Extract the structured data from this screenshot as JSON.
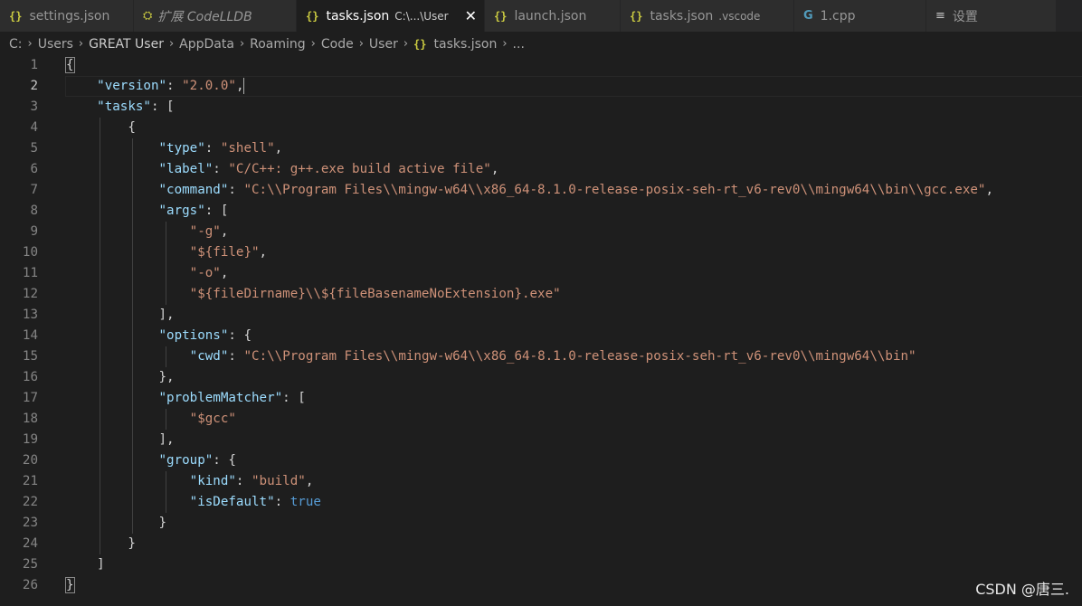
{
  "tabs": [
    {
      "icon": "json-braces-icon",
      "label": "settings.json",
      "desc": "",
      "active": false,
      "italic": false
    },
    {
      "icon": "extension-icon",
      "label": "扩展 CodeLLDB",
      "desc": "",
      "active": false,
      "italic": true
    },
    {
      "icon": "json-braces-icon",
      "label": "tasks.json",
      "desc": "C:\\...\\User",
      "active": true,
      "italic": false
    },
    {
      "icon": "json-braces-icon",
      "label": "launch.json",
      "desc": "",
      "active": false,
      "italic": false
    },
    {
      "icon": "json-braces-icon",
      "label": "tasks.json",
      "desc": ".vscode",
      "active": false,
      "italic": false
    },
    {
      "icon": "cpp-icon",
      "label": "1.cpp",
      "desc": "",
      "active": false,
      "italic": false
    },
    {
      "icon": "menu-icon",
      "label": "设置",
      "desc": "",
      "active": false,
      "italic": false
    }
  ],
  "breadcrumb": [
    "C:",
    "Users",
    "GREAT User",
    "AppData",
    "Roaming",
    "Code",
    "User",
    "tasks.json",
    "..."
  ],
  "editor": {
    "current_line": 2,
    "lines": [
      "{",
      "    \"version\": \"2.0.0\",",
      "    \"tasks\": [",
      "        {",
      "            \"type\": \"shell\",",
      "            \"label\": \"C/C++: g++.exe build active file\",",
      "            \"command\": \"C:\\\\Program Files\\\\mingw-w64\\\\x86_64-8.1.0-release-posix-seh-rt_v6-rev0\\\\mingw64\\\\bin\\\\gcc.exe\",",
      "            \"args\": [",
      "                \"-g\",",
      "                \"${file}\",",
      "                \"-o\",",
      "                \"${fileDirname}\\\\${fileBasenameNoExtension}.exe\"",
      "            ],",
      "            \"options\": {",
      "                \"cwd\": \"C:\\\\Program Files\\\\mingw-w64\\\\x86_64-8.1.0-release-posix-seh-rt_v6-rev0\\\\mingw64\\\\bin\"",
      "            },",
      "            \"problemMatcher\": [",
      "                \"$gcc\"",
      "            ],",
      "            \"group\": {",
      "                \"kind\": \"build\",",
      "                \"isDefault\": true",
      "            }",
      "        }",
      "    ]",
      "}"
    ]
  },
  "watermark": "CSDN @唐三.",
  "colors": {
    "background": "#1e1e1e",
    "key": "#9cdcfe",
    "string": "#ce9178",
    "boolean": "#569cd6",
    "icon_json": "#cbcb41",
    "icon_cpp": "#519aba"
  }
}
